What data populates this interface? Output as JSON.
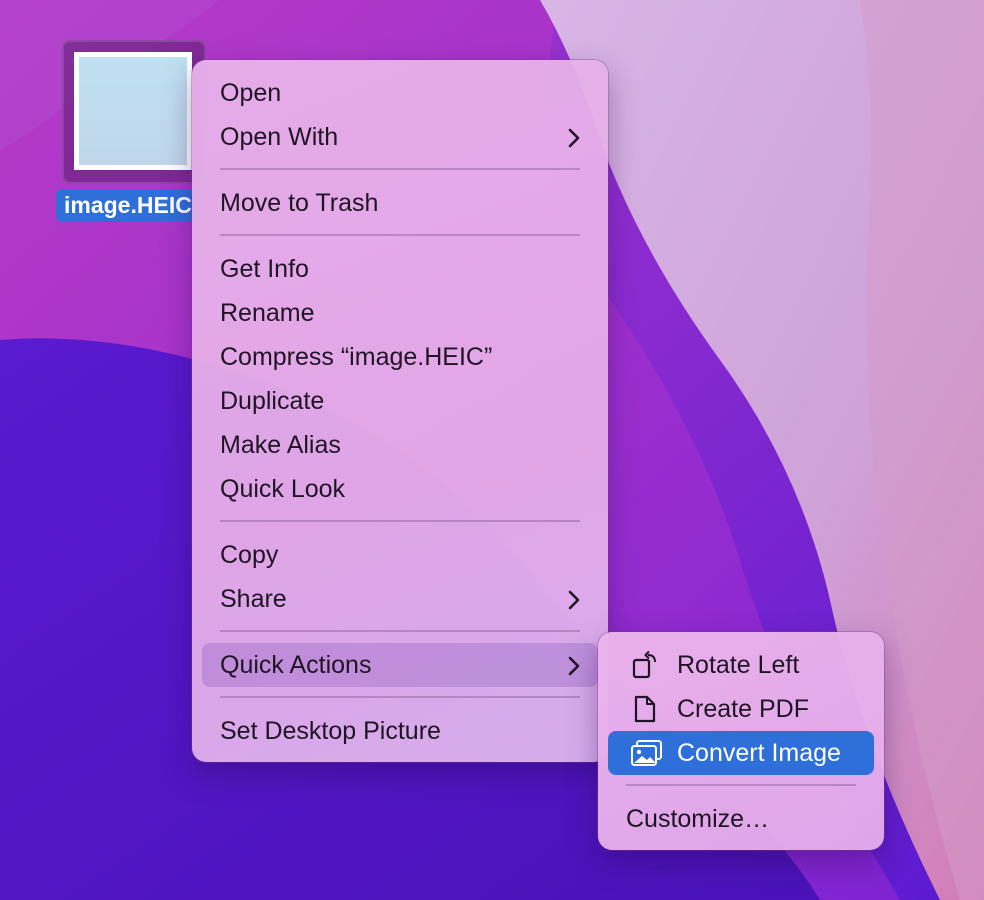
{
  "desktop_file": {
    "name": "image.HEIC"
  },
  "context_menu": {
    "items": [
      {
        "label": "Open"
      },
      {
        "label": "Open With",
        "submenu": true
      },
      {
        "label": "Move to Trash"
      },
      {
        "label": "Get Info"
      },
      {
        "label": "Rename"
      },
      {
        "label": "Compress “image.HEIC”"
      },
      {
        "label": "Duplicate"
      },
      {
        "label": "Make Alias"
      },
      {
        "label": "Quick Look"
      },
      {
        "label": "Copy"
      },
      {
        "label": "Share",
        "submenu": true
      },
      {
        "label": "Quick Actions",
        "submenu": true,
        "highlighted": true
      },
      {
        "label": "Set Desktop Picture"
      }
    ]
  },
  "quick_actions_submenu": {
    "items": [
      {
        "label": "Rotate Left",
        "icon": "rotate-left-icon"
      },
      {
        "label": "Create PDF",
        "icon": "document-icon"
      },
      {
        "label": "Convert Image",
        "icon": "photos-icon",
        "selected": true
      },
      {
        "label": "Customize…"
      }
    ]
  },
  "colors": {
    "selection_blue": "#2f6fd9",
    "menu_text": "#1f1424"
  }
}
